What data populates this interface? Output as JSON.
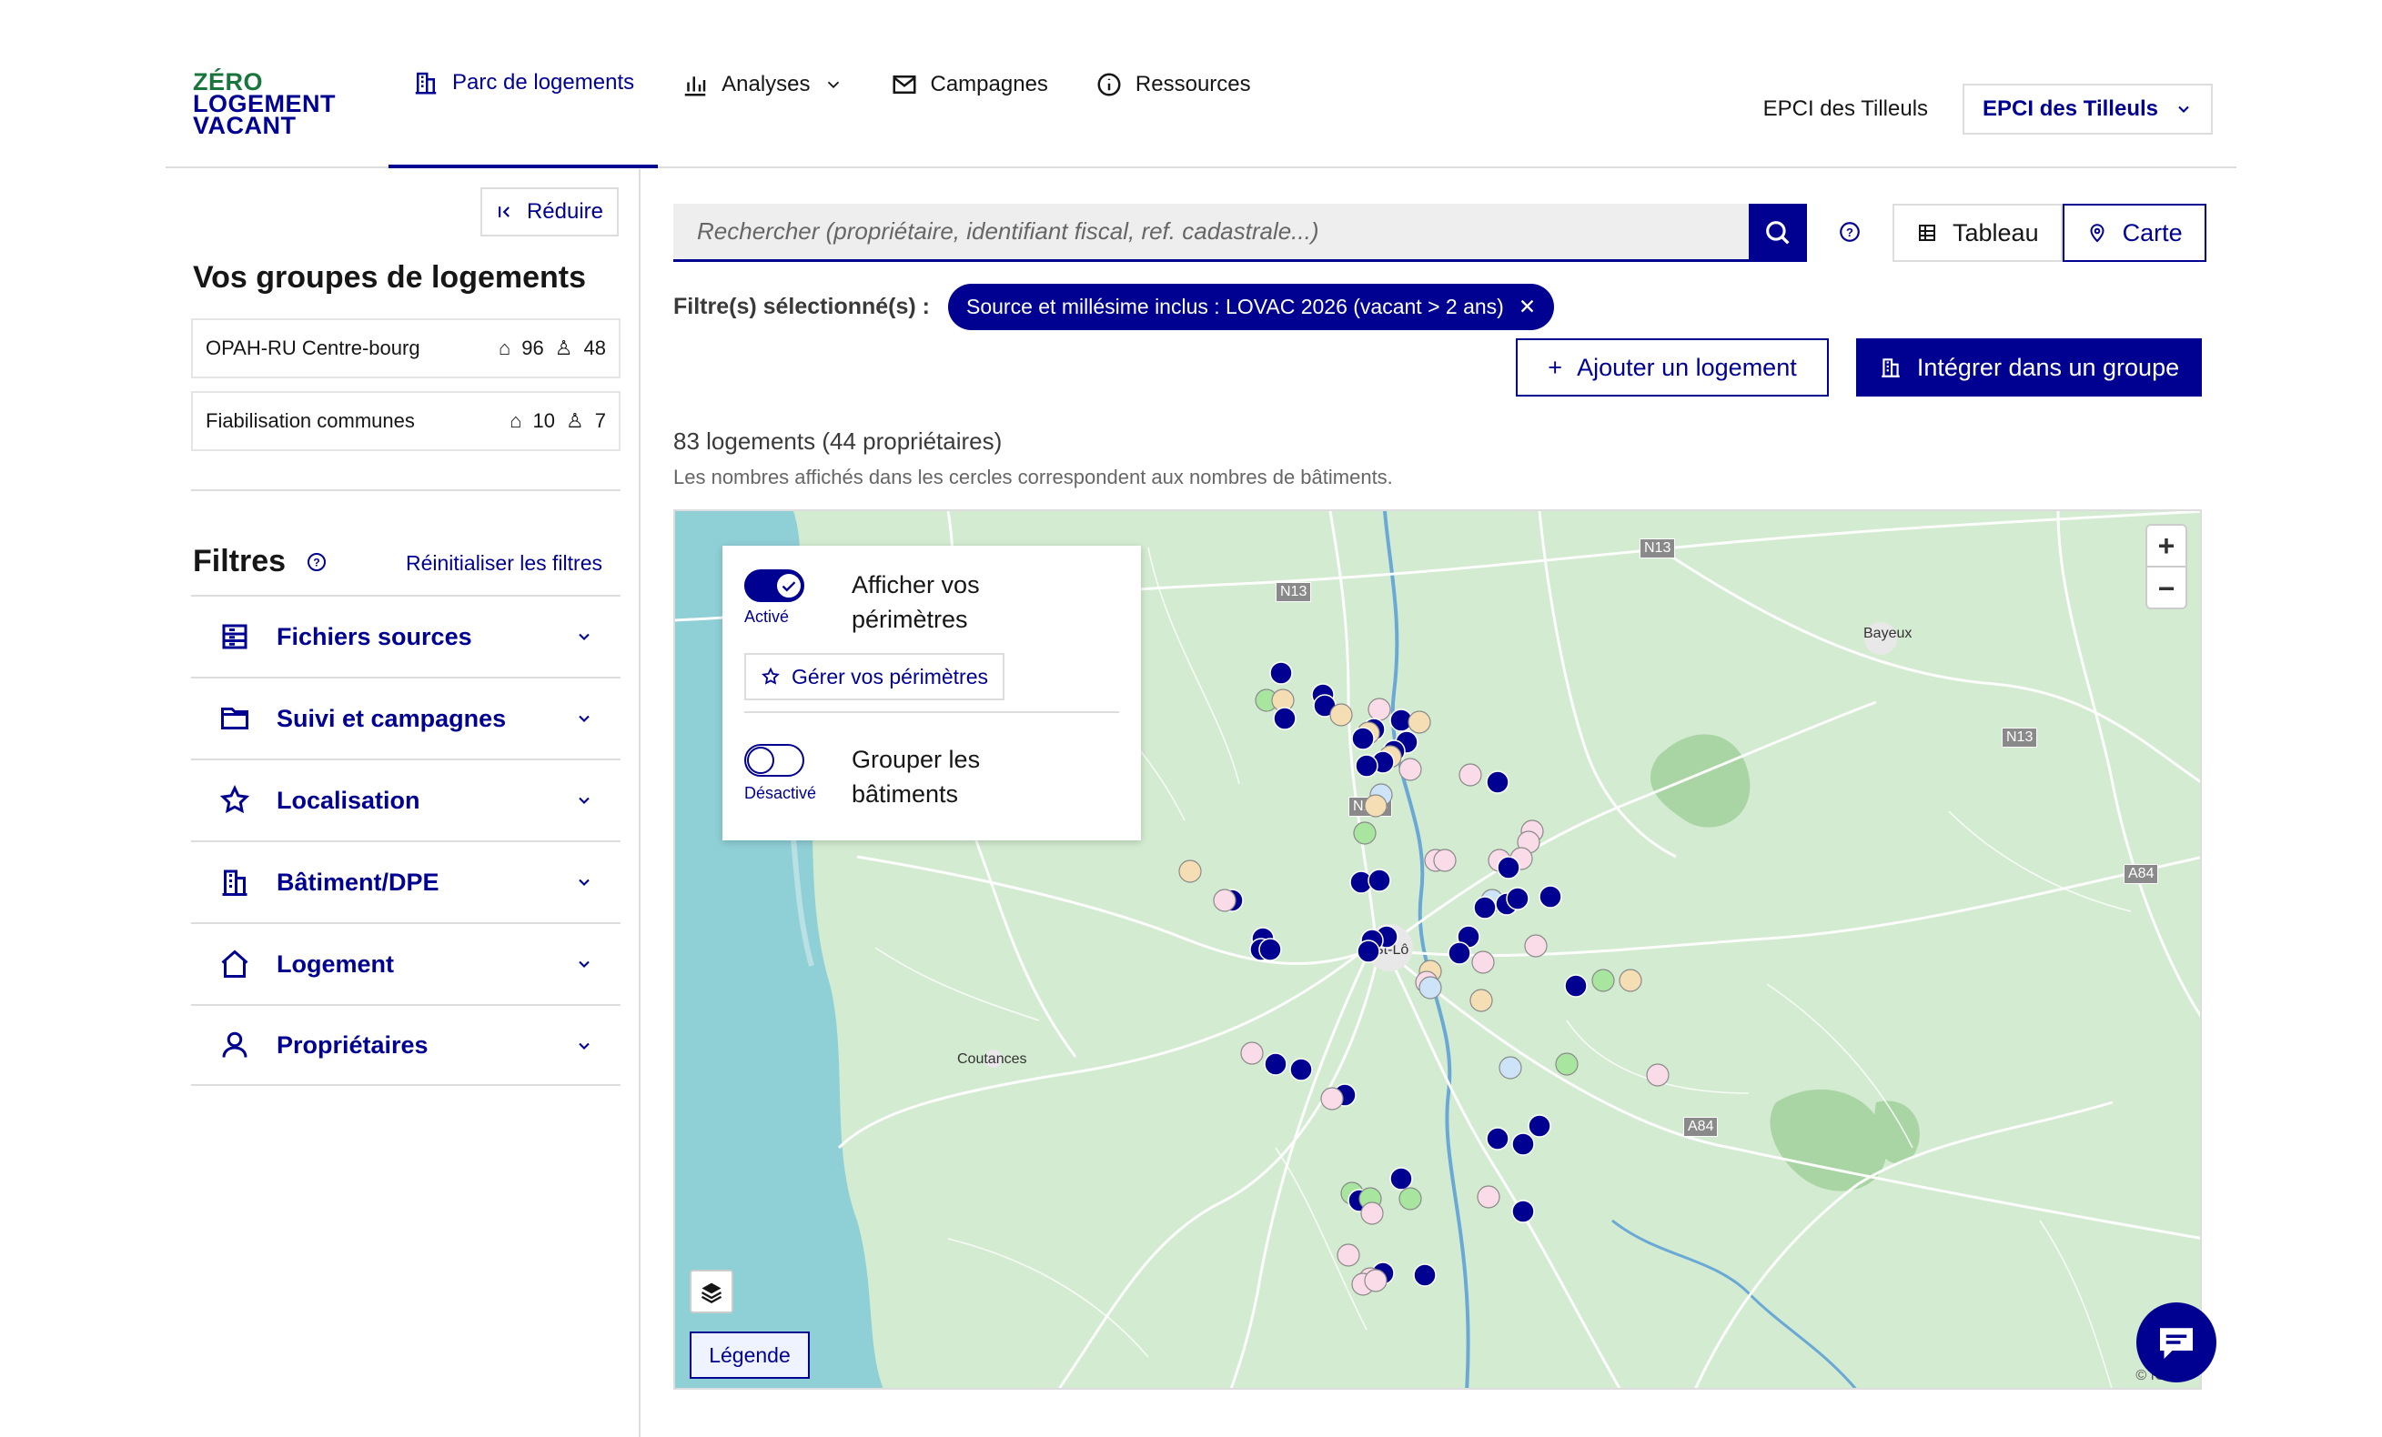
{
  "header": {
    "logo": [
      "ZÉRO",
      "LOGEMENT",
      "VACANT"
    ],
    "nav": [
      {
        "label": "Parc de logements",
        "icon": "building-icon",
        "active": true
      },
      {
        "label": "Analyses",
        "icon": "chart-icon",
        "dropdown": true
      },
      {
        "label": "Campagnes",
        "icon": "mail-icon"
      },
      {
        "label": "Ressources",
        "icon": "info-icon"
      }
    ],
    "epci_label": "EPCI des Tilleuls",
    "epci_select": "EPCI des Tilleuls"
  },
  "sidebar": {
    "reduce_label": "Réduire",
    "groups_title": "Vos groupes de logements",
    "groups": [
      {
        "name": "OPAH-RU Centre-bourg",
        "housing": "96",
        "owners": "48"
      },
      {
        "name": "Fiabilisation communes",
        "housing": "10",
        "owners": "7"
      }
    ],
    "filters_title": "Filtres",
    "reset_label": "Réinitialiser les filtres",
    "filters": [
      {
        "label": "Fichiers sources",
        "icon": "file-list-icon"
      },
      {
        "label": "Suivi et campagnes",
        "icon": "folder-icon"
      },
      {
        "label": "Localisation",
        "icon": "map-star-icon"
      },
      {
        "label": "Bâtiment/DPE",
        "icon": "building-icon"
      },
      {
        "label": "Logement",
        "icon": "home-icon"
      },
      {
        "label": "Propriétaires",
        "icon": "user-icon"
      }
    ]
  },
  "main": {
    "search_placeholder": "Rechercher (propriétaire, identifiant fiscal, ref. cadastrale...)",
    "view_table": "Tableau",
    "view_map": "Carte",
    "filters_selected_label": "Filtre(s) sélectionné(s) :",
    "chip_label": "Source et millésime inclus : LOVAC 2026 (vacant > 2 ans)",
    "add_housing": "Ajouter un logement",
    "add_to_group": "Intégrer dans un groupe",
    "count_text": "83 logements (44 propriétaires)",
    "count_note": "Les nombres affichés dans les cercles correspondent aux nombres de bâtiments."
  },
  "map": {
    "panel": {
      "toggle1_state": "Activé",
      "toggle1_text": "Afficher vos périmètres",
      "manage_label": "Gérer vos périmètres",
      "toggle2_state": "Désactivé",
      "toggle2_text": "Grouper les bâtiments"
    },
    "places": [
      "Bayeux",
      "St-Lô",
      "Coutances"
    ],
    "roads": [
      "N13",
      "N13",
      "N13",
      "N174",
      "A84",
      "A84"
    ],
    "legend_label": "Légende",
    "attribution": "© IGN",
    "colors": {
      "water": "#8fcfd6",
      "land": "#d3ebd0",
      "vacant_long": "#000091",
      "beige": "#f5deb3",
      "pink": "#fadbe8",
      "green": "#a8e6a0",
      "lightblue": "#cde3f7"
    }
  },
  "chat": {
    "icon": "chat-icon"
  }
}
